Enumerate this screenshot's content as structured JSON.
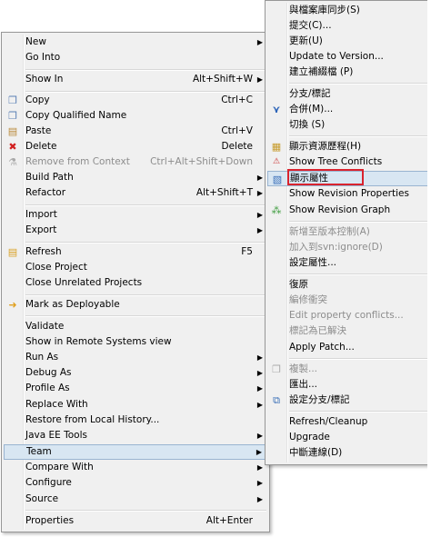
{
  "left_menu": {
    "new": "New",
    "go_into": "Go Into",
    "show_in": "Show In",
    "show_in_sc": "Alt+Shift+W",
    "copy": "Copy",
    "copy_sc": "Ctrl+C",
    "copy_qualified": "Copy Qualified Name",
    "paste": "Paste",
    "paste_sc": "Ctrl+V",
    "delete": "Delete",
    "delete_sc": "Delete",
    "remove_context": "Remove from Context",
    "remove_context_sc": "Ctrl+Alt+Shift+Down",
    "build_path": "Build Path",
    "refactor": "Refactor",
    "refactor_sc": "Alt+Shift+T",
    "import": "Import",
    "export": "Export",
    "refresh": "Refresh",
    "refresh_sc": "F5",
    "close_project": "Close Project",
    "close_unrelated": "Close Unrelated Projects",
    "mark_deployable": "Mark as Deployable",
    "validate": "Validate",
    "show_remote": "Show in Remote Systems view",
    "run_as": "Run As",
    "debug_as": "Debug As",
    "profile_as": "Profile As",
    "replace_with": "Replace With",
    "restore_history": "Restore from Local History...",
    "java_ee_tools": "Java EE Tools",
    "team": "Team",
    "compare_with": "Compare With",
    "configure": "Configure",
    "source": "Source",
    "properties": "Properties",
    "properties_sc": "Alt+Enter"
  },
  "right_menu": {
    "sync": "與檔案庫同步(S)",
    "commit": "提交(C)...",
    "update": "更新(U)",
    "update_version": "Update to Version...",
    "create_patch": "建立補綴檔 (P)",
    "branch_tag": "分支/標記",
    "merge": "合併(M)...",
    "switch": "切換 (S)",
    "show_history": "顯示資源歷程(H)",
    "show_tree_conflicts": "Show Tree Conflicts",
    "show_properties": "顯示屬性",
    "show_revision_properties": "Show Revision Properties",
    "show_revision_graph": "Show Revision Graph",
    "add_version_control": "新增至版本控制(A)",
    "add_svn_ignore": "加入到svn:ignore(D)",
    "set_property": "設定屬性...",
    "revert": "復原",
    "edit_conflicts": "編修衝突",
    "edit_property_conflicts": "Edit property conflicts...",
    "mark_resolved": "標記為已解決",
    "apply_patch": "Apply Patch...",
    "copy": "複製...",
    "export": "匯出...",
    "set_branch_tag": "設定分支/標記",
    "refresh_cleanup": "Refresh/Cleanup",
    "upgrade": "Upgrade",
    "disconnect": "中斷連線(D)"
  },
  "icons": {
    "copy": "copy-icon",
    "copy_qualified": "copy-qualified-icon",
    "paste": "paste-icon",
    "delete": "delete-icon",
    "remove_context": "remove-context-icon",
    "refresh": "refresh-icon",
    "mark_deployable": "mark-deployable-icon",
    "merge": "merge-icon",
    "history": "history-icon",
    "properties": "properties-icon",
    "revision_graph": "revision-graph-icon",
    "svn_copy": "svn-copy-icon",
    "branch_tag": "branch-tag-icon"
  },
  "colors": {
    "highlight": "#d8e6f2",
    "highlight_border": "#99b4d1",
    "callout": "#d9232e",
    "disabled": "#8d8d8d"
  }
}
